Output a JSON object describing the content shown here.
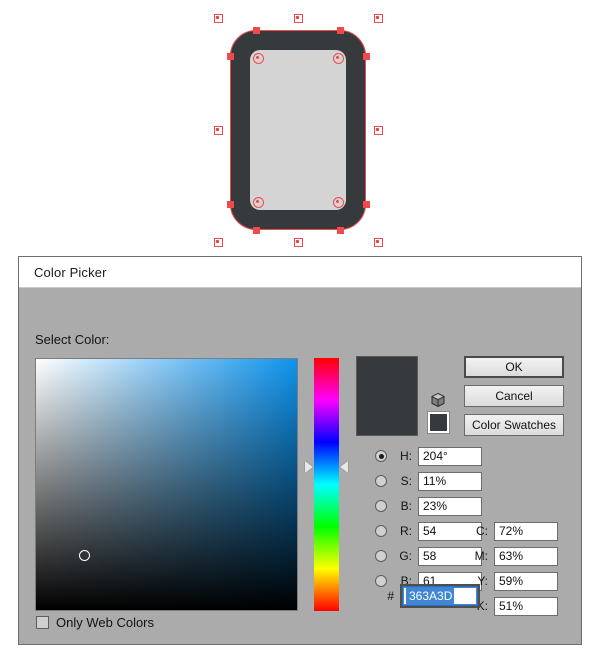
{
  "canvas": {
    "background_color": "#FFFFFF",
    "artwork": {
      "name": "rounded-rectangle-shape",
      "outer_fill": "#363A3D",
      "inner_fill": "#D4D4D4",
      "selection_color": "#F2494D",
      "selected": true
    }
  },
  "dialog": {
    "title": "Color Picker",
    "section_label": "Select Color:",
    "buttons": {
      "ok": "OK",
      "cancel": "Cancel",
      "color_swatches": "Color Swatches"
    },
    "preview": {
      "new_color": "#363A3D",
      "current_color": "#363A3D"
    },
    "hsb": [
      {
        "key": "H",
        "label": "H:",
        "value": "204°",
        "selected": true
      },
      {
        "key": "S",
        "label": "S:",
        "value": "11%",
        "selected": false
      },
      {
        "key": "B",
        "label": "B:",
        "value": "23%",
        "selected": false
      }
    ],
    "rgb": [
      {
        "key": "R",
        "label": "R:",
        "value": "54",
        "selected": false
      },
      {
        "key": "G",
        "label": "G:",
        "value": "58",
        "selected": false
      },
      {
        "key": "B",
        "label": "B:",
        "value": "61",
        "selected": false
      }
    ],
    "cmyk": [
      {
        "key": "C",
        "label": "C:",
        "value": "72%"
      },
      {
        "key": "M",
        "label": "M:",
        "value": "63%"
      },
      {
        "key": "Y",
        "label": "Y:",
        "value": "59%"
      },
      {
        "key": "K",
        "label": "K:",
        "value": "51%"
      }
    ],
    "hex": {
      "prefix": "#",
      "value": "363A3D",
      "selected": true,
      "focused": true
    },
    "only_web_colors": {
      "label": "Only Web Colors",
      "checked": false
    },
    "hue_slider": {
      "hue": 204,
      "marker_position_percent": 57
    },
    "sb_square": {
      "saturation_percent": 11,
      "brightness_percent": 23,
      "hue_color": "#0D93EE"
    }
  }
}
